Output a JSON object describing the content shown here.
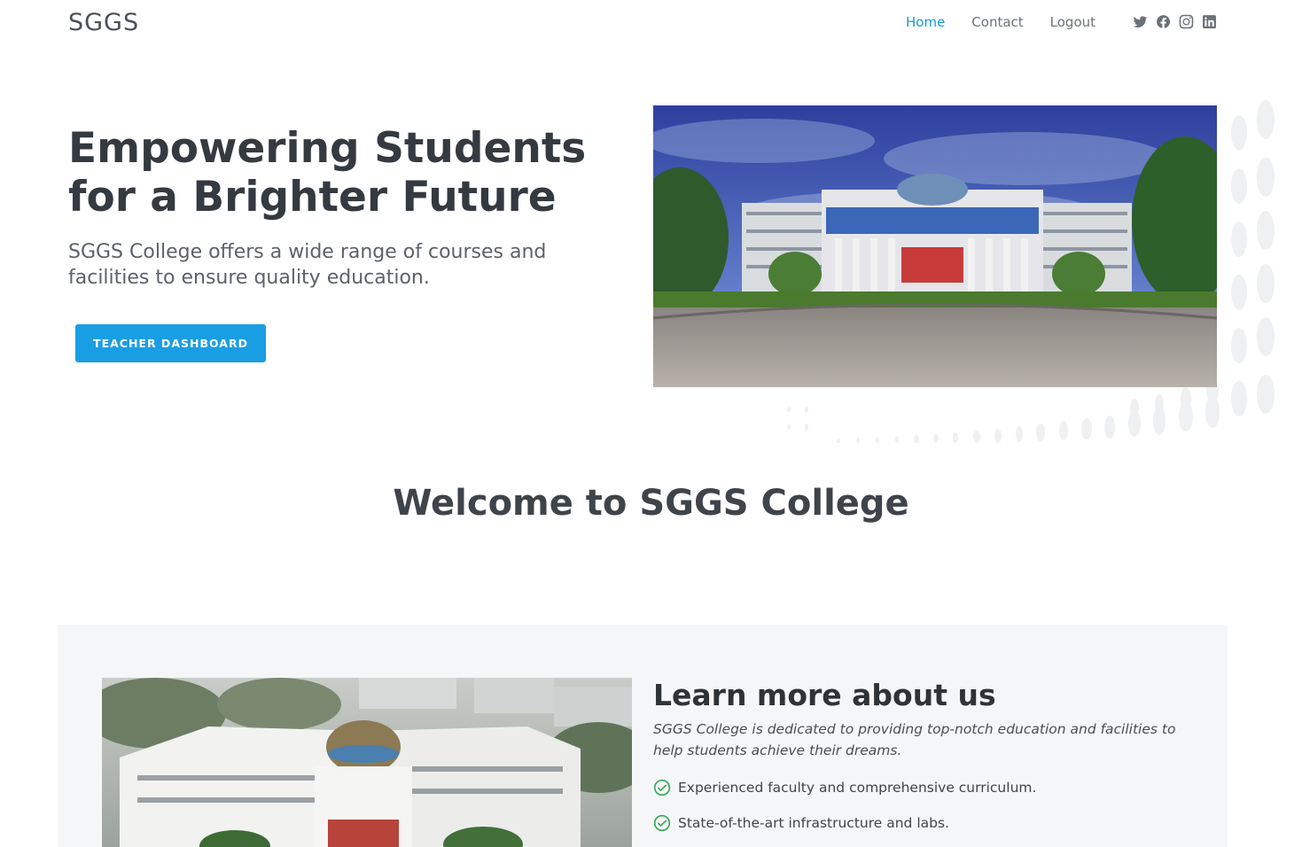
{
  "header": {
    "logo": "SGGS",
    "nav": [
      {
        "label": "Home",
        "active": true
      },
      {
        "label": "Contact",
        "active": false
      },
      {
        "label": "Logout",
        "active": false
      }
    ],
    "socials": [
      "twitter-icon",
      "facebook-icon",
      "instagram-icon",
      "linkedin-icon"
    ]
  },
  "hero": {
    "title": "Empowering Students for a Brighter Future",
    "subtitle": "SGGS College offers a wide range of courses and facilities to ensure quality education.",
    "button_label": "TEACHER DASHBOARD",
    "image": "college-building-photo"
  },
  "welcome": {
    "title": "Welcome to SGGS College"
  },
  "about": {
    "title": "Learn more about us",
    "description": "SGGS College is dedicated to providing top-notch education and facilities to help students achieve their dreams.",
    "features": [
      "Experienced faculty and comprehensive curriculum.",
      "State-of-the-art infrastructure and labs."
    ],
    "image": "college-aerial-photo"
  },
  "colors": {
    "accent": "#1a9ee3",
    "nav_active": "#1a9ad9",
    "check": "#3aa85a",
    "section_bg": "#f5f6f8"
  }
}
